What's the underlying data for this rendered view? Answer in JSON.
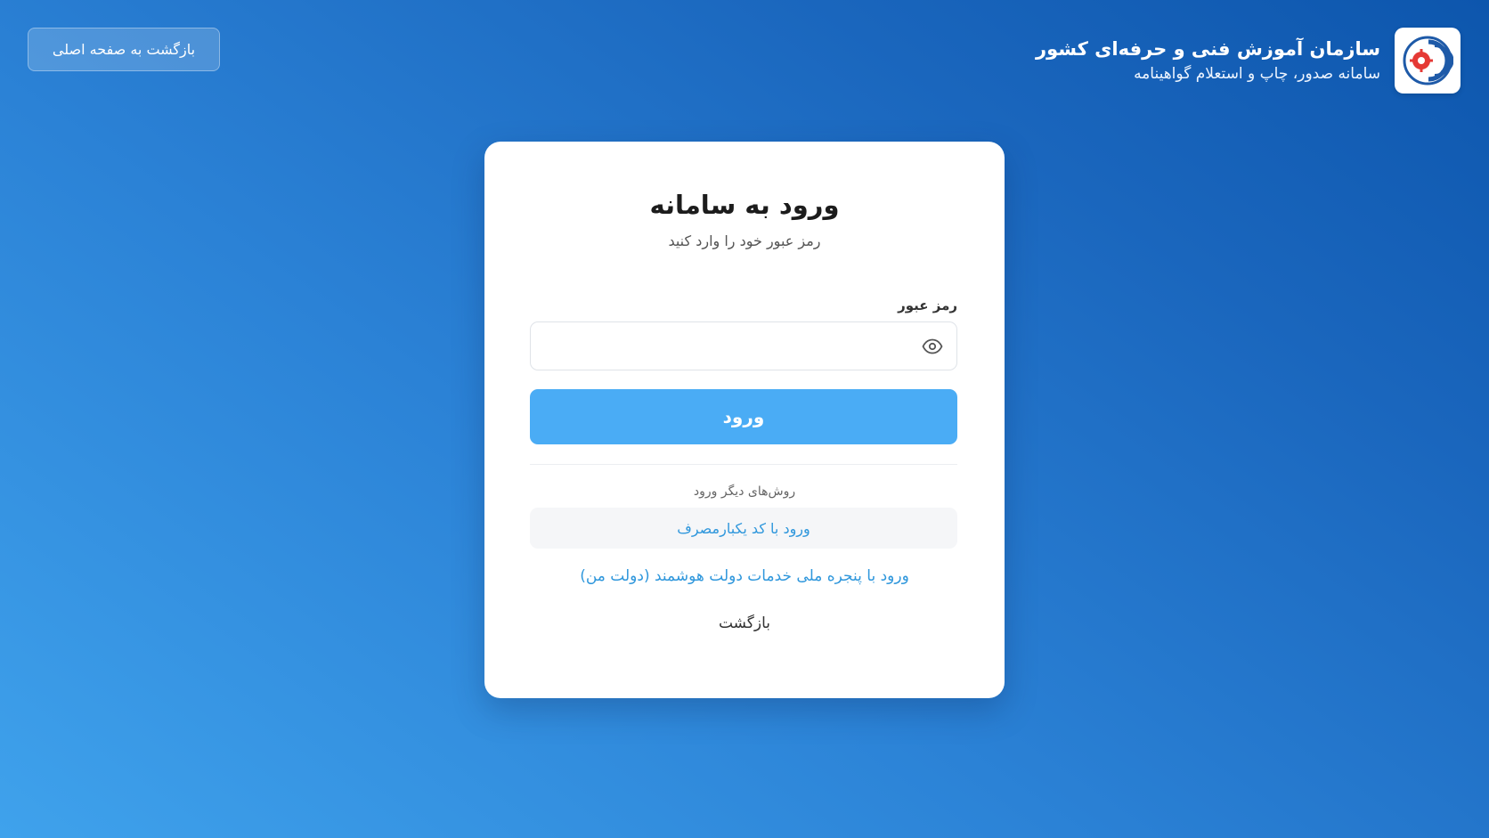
{
  "header": {
    "title": "سازمان آموزش فنی و حرفه‌ای کشور",
    "subtitle": "سامانه صدور، چاپ و استعلام گواهینامه",
    "logo_icon": "organization-logo-icon",
    "back_home_label": "بازگشت به صفحه اصلی"
  },
  "card": {
    "title": "ورود به سامانه",
    "subtitle": "رمز عبور خود را وارد کنید",
    "password_label": "رمز عبور",
    "password_value": "",
    "password_placeholder": "",
    "toggle_visibility_icon": "eye-icon",
    "submit_label": "ورود",
    "other_methods_label": "روش‌های دیگر ورود",
    "otp_login_label": "ورود با کد یکبارمصرف",
    "gov_login_label": "ورود با پنجره ملی خدمات دولت هوشمند (دولت من)",
    "back_label": "بازگشت"
  },
  "colors": {
    "background_top": "#0d56ad",
    "background_bottom": "#3fa2ec",
    "primary_button": "#4aacf5",
    "link": "#2f97dc",
    "logo_red": "#e53935",
    "logo_blue": "#1e5aa8"
  }
}
